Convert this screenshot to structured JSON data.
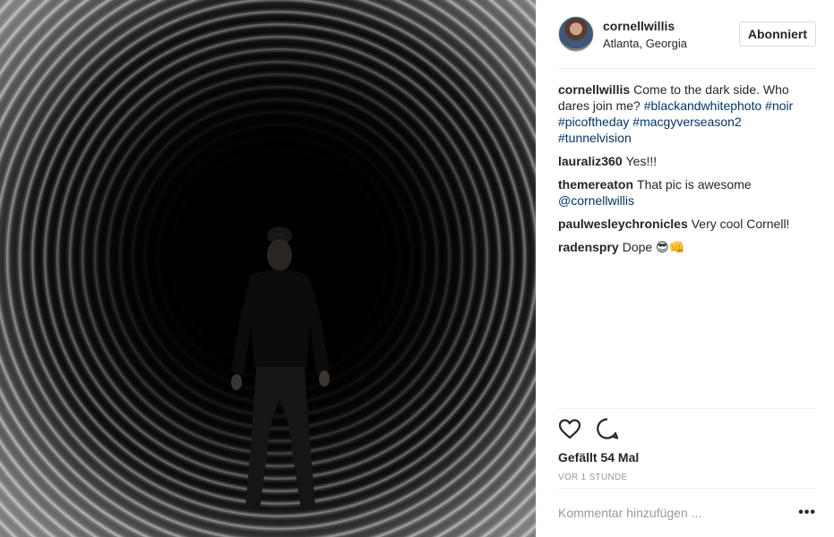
{
  "post": {
    "username": "cornellwillis",
    "location": "Atlanta, Georgia",
    "follow_label": "Abonniert",
    "caption": {
      "user": "cornellwillis",
      "text": "Come to the dark side. Who dares join me?",
      "tags": [
        "#blackandwhitephoto",
        "#noir",
        "#picoftheday",
        "#macgyverseason2",
        "#tunnelvision"
      ]
    },
    "comments": [
      {
        "user": "lauraliz360",
        "text": "Yes!!!"
      },
      {
        "user": "themereaton",
        "text": "That pic is awesome",
        "mention": "@cornellwillis"
      },
      {
        "user": "paulwesleychronicles",
        "text": "Very cool Cornell!"
      },
      {
        "user": "radenspry",
        "text": "Dope 😎👊"
      }
    ],
    "likes_label": "Gefällt 54 Mal",
    "time_ago": "VOR 1 STUNDE",
    "comment_placeholder": "Kommentar hinzufügen ...",
    "more_icon": "more-options-icon",
    "like_icon": "heart-icon",
    "comment_icon": "speech-bubble-icon"
  }
}
